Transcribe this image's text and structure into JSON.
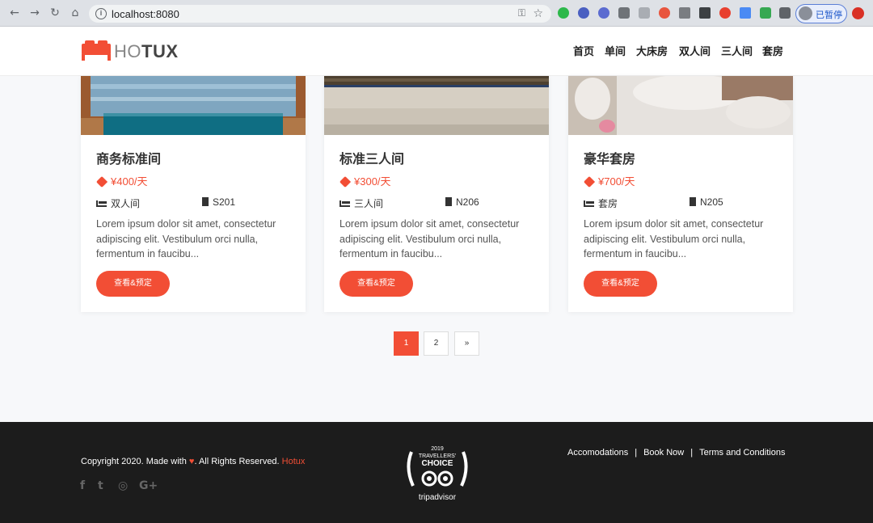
{
  "browser": {
    "url": "localhost:8080",
    "profile_label": "已暂停"
  },
  "header": {
    "logo_light": "HO",
    "logo_bold": "TUX",
    "nav": [
      "首页",
      "单间",
      "大床房",
      "双人间",
      "三人间",
      "套房"
    ]
  },
  "cards": [
    {
      "title": "商务标准间",
      "price": "¥400/天",
      "bed_type": "双人间",
      "room_no": "S201",
      "description": "Lorem ipsum dolor sit amet, consectetur adipiscing elit. Vestibulum orci nulla, fermentum in faucibu...",
      "button": "查看&预定"
    },
    {
      "title": "标准三人间",
      "price": "¥300/天",
      "bed_type": "三人间",
      "room_no": "N206",
      "description": "Lorem ipsum dolor sit amet, consectetur adipiscing elit. Vestibulum orci nulla, fermentum in faucibu...",
      "button": "查看&预定"
    },
    {
      "title": "豪华套房",
      "price": "¥700/天",
      "bed_type": "套房",
      "room_no": "N205",
      "description": "Lorem ipsum dolor sit amet, consectetur adipiscing elit. Vestibulum orci nulla, fermentum in faucibu...",
      "button": "查看&预定"
    }
  ],
  "pagination": {
    "pages": [
      "1",
      "2"
    ],
    "next": "»",
    "current": "1"
  },
  "footer": {
    "copyright_prefix": "Copyright 2020. Made with",
    "heart": "♥",
    "copyright_suffix": ". All Rights Reserved.",
    "brand": "Hotux",
    "social_icons": [
      "facebook-icon",
      "twitter-icon",
      "instagram-icon",
      "google-plus-icon"
    ],
    "social_glyphs": [
      "f",
      "t",
      "◎",
      "G+"
    ],
    "badge": {
      "year": "2019",
      "line1": "TRAVELLERS'",
      "line2": "CHOICE",
      "brand": "tripadvisor"
    },
    "links": [
      "Accomodations",
      "Book Now",
      "Terms and Conditions"
    ]
  },
  "colors": {
    "accent": "#f24e35",
    "footer_bg": "#1c1c1c"
  }
}
